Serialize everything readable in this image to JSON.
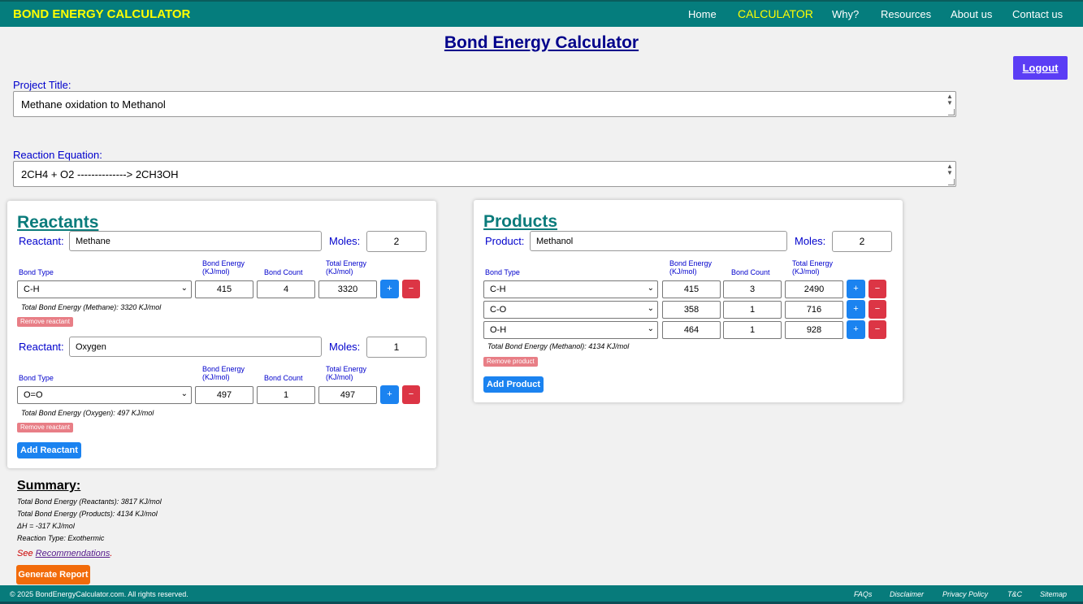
{
  "nav": {
    "brand": "BOND ENERGY CALCULATOR",
    "links": [
      "Home",
      "CALCULATOR",
      "Why?",
      "Resources",
      "About us",
      "Contact us"
    ],
    "active_color": "#ffff00"
  },
  "page_title": "Bond Energy Calculator",
  "logout_label": "Logout",
  "project": {
    "label": "Project Title:",
    "value": "Methane oxidation to Methanol"
  },
  "equation": {
    "label": "Reaction Equation:",
    "value": "2CH4 + O2 --------------> 2CH3OH"
  },
  "headers": {
    "bond_type": "Bond Type",
    "bond_energy_1": "Bond Energy",
    "bond_energy_2": "(KJ/mol)",
    "bond_count": "Bond Count",
    "total_energy_1": "Total Energy",
    "total_energy_2": "(KJ/mol)"
  },
  "reactants": {
    "title": "Reactants",
    "item_label": "Reactant:",
    "moles_label": "Moles:",
    "remove_label": "Remove reactant",
    "add_label": "Add Reactant",
    "items": [
      {
        "name": "Methane",
        "moles": "2",
        "bonds": [
          {
            "type": "C-H",
            "energy": "415",
            "count": "4",
            "total": "3320"
          }
        ],
        "total_note": "Total Bond Energy (Methane): 3320 KJ/mol"
      },
      {
        "name": "Oxygen",
        "moles": "1",
        "bonds": [
          {
            "type": "O=O",
            "energy": "497",
            "count": "1",
            "total": "497"
          }
        ],
        "total_note": "Total Bond Energy (Oxygen): 497 KJ/mol"
      }
    ]
  },
  "products": {
    "title": "Products",
    "item_label": "Product:",
    "moles_label": "Moles:",
    "remove_label": "Remove product",
    "add_label": "Add Product",
    "items": [
      {
        "name": "Methanol",
        "moles": "2",
        "bonds": [
          {
            "type": "C-H",
            "energy": "415",
            "count": "3",
            "total": "2490"
          },
          {
            "type": "C-O",
            "energy": "358",
            "count": "1",
            "total": "716"
          },
          {
            "type": "O-H",
            "energy": "464",
            "count": "1",
            "total": "928"
          }
        ],
        "total_note": "Total Bond Energy (Methanol): 4134 KJ/mol"
      }
    ]
  },
  "buttons": {
    "plus": "+",
    "minus": "−"
  },
  "summary": {
    "title": "Summary:",
    "reactants_total": "Total Bond Energy (Reactants): 3817 KJ/mol",
    "products_total": "Total Bond Energy (Products): 4134 KJ/mol",
    "delta_h": "ΔH = -317 KJ/mol",
    "reaction_type": "Reaction Type: Exothermic",
    "see_prefix": "See ",
    "see_link": "Recommendations",
    "see_suffix": "."
  },
  "generate_label": "Generate Report",
  "footer": {
    "copyright": "© 2025 BondEnergyCalculator.com. All rights reserved.",
    "links": [
      "FAQs",
      "Disclaimer",
      "Privacy Policy",
      "T&C",
      "Sitemap"
    ]
  },
  "icons": {
    "select_arrow": "chevron-down-icon",
    "spin": "spinner-arrows-icon",
    "resize": "resize-grip-icon"
  }
}
